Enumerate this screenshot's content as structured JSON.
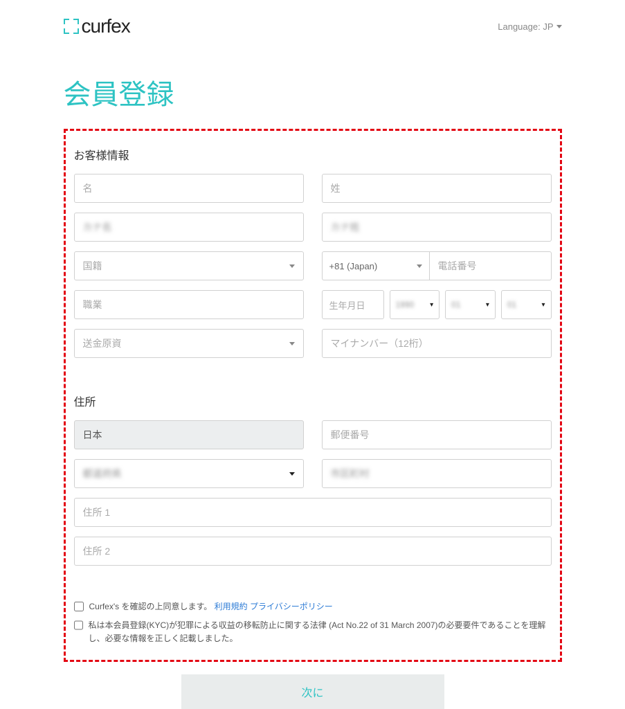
{
  "header": {
    "logo_text": "curfex",
    "language_label": "Language: JP"
  },
  "page_title": "会員登録",
  "sections": {
    "customer_info": "お客様情報",
    "address": "住所"
  },
  "fields": {
    "first_name_placeholder": "名",
    "last_name_placeholder": "姓",
    "first_kana_value": "カナ名",
    "last_kana_value": "カナ姓",
    "nationality_placeholder": "国籍",
    "phone_prefix": "+81 (Japan)",
    "phone_placeholder": "電話番号",
    "occupation_placeholder": "職業",
    "dob_label": "生年月日",
    "dob_year": "1990",
    "dob_month": "01",
    "dob_day": "01",
    "funds_source_placeholder": "送金原資",
    "mynumber_placeholder": "マイナンバー（12桁）",
    "country_value": "日本",
    "postal_placeholder": "郵便番号",
    "prefecture_value": "都道府県",
    "city_value": "市区町村",
    "address1_placeholder": "住所 1",
    "address2_placeholder": "住所 2"
  },
  "checks": {
    "terms_prefix": "Curfex's を確認の上同意します。",
    "terms_link1": "利用規約",
    "terms_link2": "プライバシーポリシー",
    "kyc_text": "私は本会員登録(KYC)が犯罪による収益の移転防止に関する法律 (Act No.22 of 31 March 2007)の必要要件であることを理解し、必要な情報を正しく記載しました。"
  },
  "next_button": "次に"
}
